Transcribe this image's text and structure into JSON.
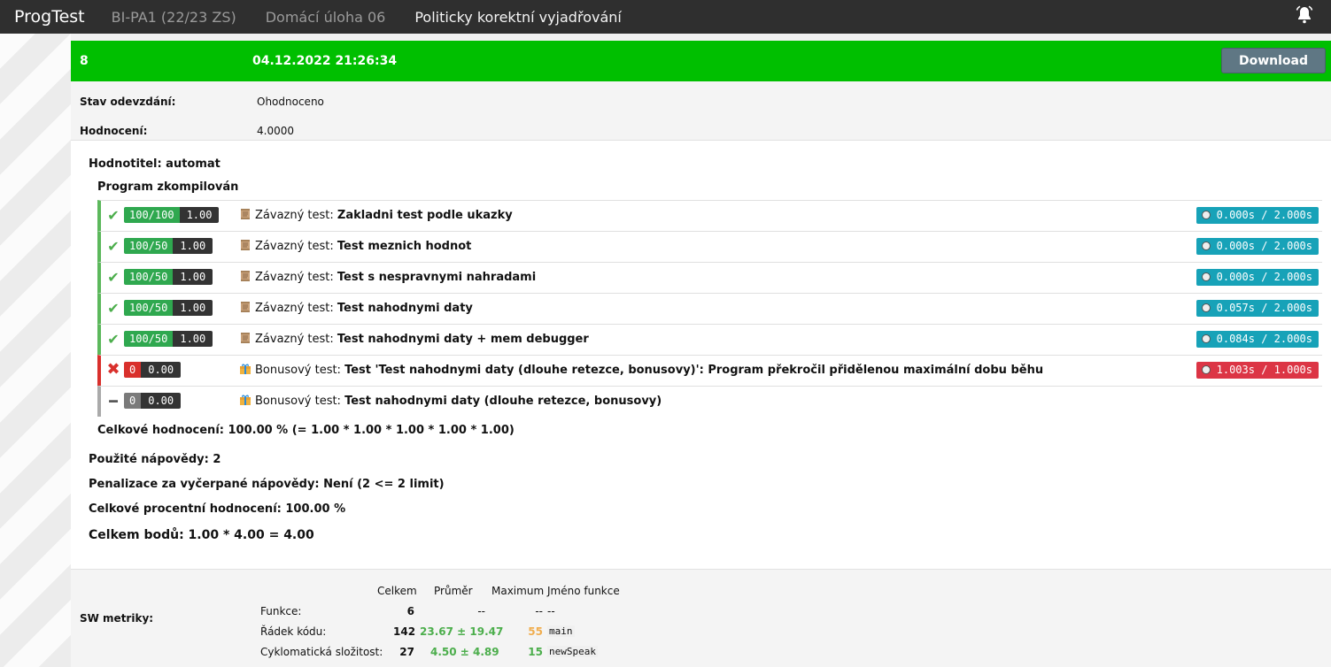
{
  "nav": {
    "brand": "ProgTest",
    "items": [
      "BI-PA1 (22/23 ZS)",
      "Domácí úloha 06",
      "Politicky korektní vyjadřování"
    ]
  },
  "submission": {
    "id": "8",
    "date": "04.12.2022 21:26:34",
    "download_label": "Download",
    "status_key": "Stav odevzdání:",
    "status_val": "Ohodnoceno",
    "grade_key": "Hodnocení:",
    "grade_val": "4.0000"
  },
  "results": {
    "evaluator": "Hodnotitel: automat",
    "compiled": "Program zkompilován",
    "tests": [
      {
        "status": "pass",
        "score": "100/100",
        "factor": "1.00",
        "kind": "Závazný test:",
        "name": "Zakladni test podle ukazky",
        "time": "0.000s / 2.000s"
      },
      {
        "status": "pass",
        "score": "100/50",
        "factor": "1.00",
        "kind": "Závazný test:",
        "name": "Test meznich hodnot",
        "time": "0.000s / 2.000s"
      },
      {
        "status": "pass",
        "score": "100/50",
        "factor": "1.00",
        "kind": "Závazný test:",
        "name": "Test s nespravnymi nahradami",
        "time": "0.000s / 2.000s"
      },
      {
        "status": "pass",
        "score": "100/50",
        "factor": "1.00",
        "kind": "Závazný test:",
        "name": "Test nahodnymi daty",
        "time": "0.057s / 2.000s"
      },
      {
        "status": "pass",
        "score": "100/50",
        "factor": "1.00",
        "kind": "Závazný test:",
        "name": "Test nahodnymi daty + mem debugger",
        "time": "0.084s / 2.000s"
      },
      {
        "status": "fail",
        "score": "0",
        "factor": "0.00",
        "kind": "Bonusový test:",
        "name": "Test 'Test nahodnymi daty (dlouhe retezce, bonusovy)': Program překročil přidělenou maximální dobu běhu",
        "time": "1.003s / 1.000s"
      },
      {
        "status": "skip",
        "score": "0",
        "factor": "0.00",
        "kind": "Bonusový test:",
        "name": "Test nahodnymi daty (dlouhe retezce, bonusovy)",
        "time": ""
      }
    ],
    "total": "Celkové hodnocení: 100.00 % (= 1.00 * 1.00 * 1.00 * 1.00 * 1.00)",
    "hints_used": "Použité nápovědy: 2",
    "penalty": "Penalizace za vyčerpané nápovědy: Není (2 <= 2 limit)",
    "percent": "Celkové procentní hodnocení: 100.00 %",
    "points": "Celkem bodů: 1.00 * 4.00 = 4.00"
  },
  "metrics": {
    "label": "SW metriky:",
    "headers": [
      "Celkem",
      "Průměr",
      "Maximum",
      "Jméno funkce"
    ],
    "rows": [
      {
        "name": "Funkce:",
        "total": "6",
        "avg": "--",
        "max": "--",
        "fn": "--"
      },
      {
        "name": "Řádek kódu:",
        "total": "142",
        "avg": "23.67 ± 19.47",
        "max": "55",
        "fn": "main"
      },
      {
        "name": "Cyklomatická složitost:",
        "total": "27",
        "avg": "4.50 ± 4.89",
        "max": "15",
        "fn": "newSpeak"
      }
    ],
    "colors": {
      "green": "#4cae4c",
      "orange": "#f0ad4e"
    }
  },
  "colors": {
    "header_green": "#00bf00",
    "pass": "#2fa84f",
    "fail": "#d9302c",
    "time": "#17a2b8"
  }
}
